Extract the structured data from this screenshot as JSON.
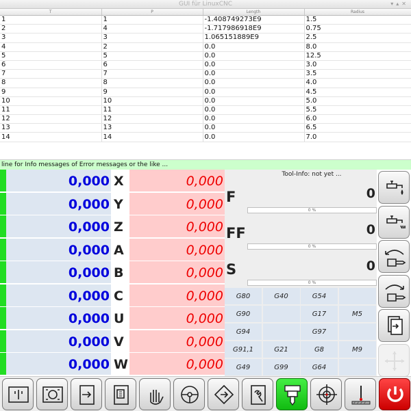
{
  "window": {
    "title": "GUI für LinuxCNC"
  },
  "tool_table": {
    "headers": [
      "T",
      "P",
      "Length",
      "Radius"
    ],
    "rows": [
      [
        "1",
        "1",
        "-1.408749273E9",
        "1.5"
      ],
      [
        "2",
        "4",
        "-1.717986918E9",
        "0.75"
      ],
      [
        "3",
        "3",
        "1.065151889E9",
        "2.5"
      ],
      [
        "4",
        "2",
        "0.0",
        "8.0"
      ],
      [
        "5",
        "5",
        "0.0",
        "12.5"
      ],
      [
        "6",
        "6",
        "0.0",
        "3.0"
      ],
      [
        "7",
        "7",
        "0.0",
        "3.5"
      ],
      [
        "8",
        "8",
        "0.0",
        "4.0"
      ],
      [
        "9",
        "9",
        "0.0",
        "4.5"
      ],
      [
        "10",
        "10",
        "0.0",
        "5.0"
      ],
      [
        "11",
        "11",
        "0.0",
        "5.5"
      ],
      [
        "12",
        "12",
        "0.0",
        "6.0"
      ],
      [
        "13",
        "13",
        "0.0",
        "6.5"
      ],
      [
        "14",
        "14",
        "0.0",
        "7.0"
      ]
    ]
  },
  "info_line": "line for Info messages of Error messages or the like ...",
  "axes": [
    {
      "letter": "X",
      "absolute": "0,000",
      "relative": "0,000"
    },
    {
      "letter": "Y",
      "absolute": "0,000",
      "relative": "0,000"
    },
    {
      "letter": "Z",
      "absolute": "0,000",
      "relative": "0,000"
    },
    {
      "letter": "A",
      "absolute": "0,000",
      "relative": "0,000"
    },
    {
      "letter": "B",
      "absolute": "0,000",
      "relative": "0,000"
    },
    {
      "letter": "C",
      "absolute": "0,000",
      "relative": "0,000"
    },
    {
      "letter": "U",
      "absolute": "0,000",
      "relative": "0,000"
    },
    {
      "letter": "V",
      "absolute": "0,000",
      "relative": "0,000"
    },
    {
      "letter": "W",
      "absolute": "0,000",
      "relative": "0,000"
    }
  ],
  "tool_info": "Tool-Info: not yet ...",
  "feeds": [
    {
      "label": "F",
      "value": "0",
      "progress": "0 %"
    },
    {
      "label": "FF",
      "value": "0",
      "progress": "0 %"
    },
    {
      "label": "S",
      "value": "0",
      "progress": "0 %"
    }
  ],
  "gcodes": [
    [
      "G80",
      "G40",
      "G54",
      ""
    ],
    [
      "G90",
      "",
      "G17",
      "M5"
    ],
    [
      "G94",
      "",
      "G97",
      ""
    ],
    [
      "G91,1",
      "G21",
      "G8",
      "M9"
    ],
    [
      "G49",
      "G99",
      "G64",
      ""
    ]
  ],
  "side_buttons": [
    {
      "icon": "coolant-flood-icon",
      "enabled": true
    },
    {
      "icon": "coolant-mist-icon",
      "enabled": true
    },
    {
      "icon": "spindle-ccw-icon",
      "enabled": true
    },
    {
      "icon": "spindle-cw-icon",
      "enabled": true
    },
    {
      "icon": "load-file-icon",
      "enabled": true
    },
    {
      "icon": "jog-cross-icon",
      "enabled": false
    }
  ],
  "bottom_buttons": [
    {
      "icon": "machine-view-icon",
      "state": "normal"
    },
    {
      "icon": "workpiece-view-icon",
      "state": "normal"
    },
    {
      "icon": "run-program-icon",
      "state": "normal"
    },
    {
      "icon": "edit-program-icon",
      "state": "normal"
    },
    {
      "icon": "manual-hand-icon",
      "state": "normal"
    },
    {
      "icon": "steering-wheel-icon",
      "state": "normal"
    },
    {
      "icon": "mdi-diamond-icon",
      "state": "normal"
    },
    {
      "icon": "wrench-settings-icon",
      "state": "normal"
    },
    {
      "icon": "tool-spindle-icon",
      "state": "active"
    },
    {
      "icon": "crosshair-touchoff-icon",
      "state": "normal"
    },
    {
      "icon": "probe-surface-icon",
      "state": "normal"
    },
    {
      "icon": "power-icon",
      "state": "emergency"
    }
  ],
  "colors": {
    "absolute_text": "#0000dd",
    "relative_text": "#ee0000",
    "relative_bg": "#ffcccc",
    "absolute_bg": "#dde6f1",
    "info_bg": "#ccffcc",
    "led_on": "#22dd22"
  }
}
